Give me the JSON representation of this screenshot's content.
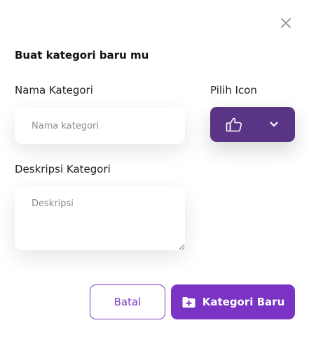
{
  "dialog": {
    "title": "Buat kategori baru mu",
    "close_icon": "close-icon"
  },
  "form": {
    "name_label": "Nama Kategori",
    "name_placeholder": "Nama kategori",
    "name_value": "",
    "icon_label": "Pilih Icon",
    "icon_selected": "thumbs-up-icon",
    "description_label": "Deskripsi Kategori",
    "description_placeholder": "Deskripsi",
    "description_value": ""
  },
  "actions": {
    "cancel_label": "Batal",
    "submit_label": "Kategori Baru",
    "submit_icon": "folder-plus-icon"
  },
  "colors": {
    "accent": "#7b33c3",
    "icon_select_bg": "#5a3586",
    "cancel_border": "#7b3fc4"
  }
}
